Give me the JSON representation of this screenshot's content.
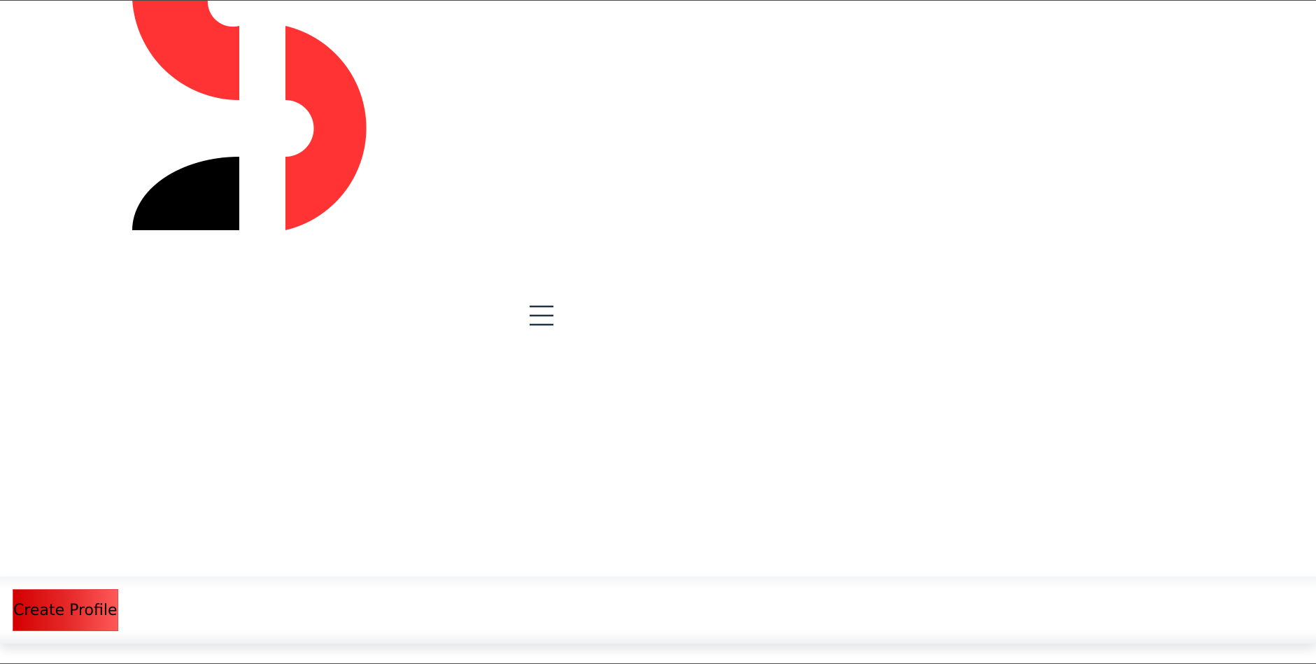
{
  "header": {
    "logo_icon": "brand-logo-icon",
    "menu_icon": "hamburger-menu-icon"
  },
  "footer": {
    "create_profile_label": "Create Profile"
  },
  "colors": {
    "brand_red": "#FF3333",
    "logo_black": "#000000",
    "menu_icon": "#1f3345",
    "button_gradient_start": "#D30000",
    "button_gradient_end": "#FF5959"
  }
}
